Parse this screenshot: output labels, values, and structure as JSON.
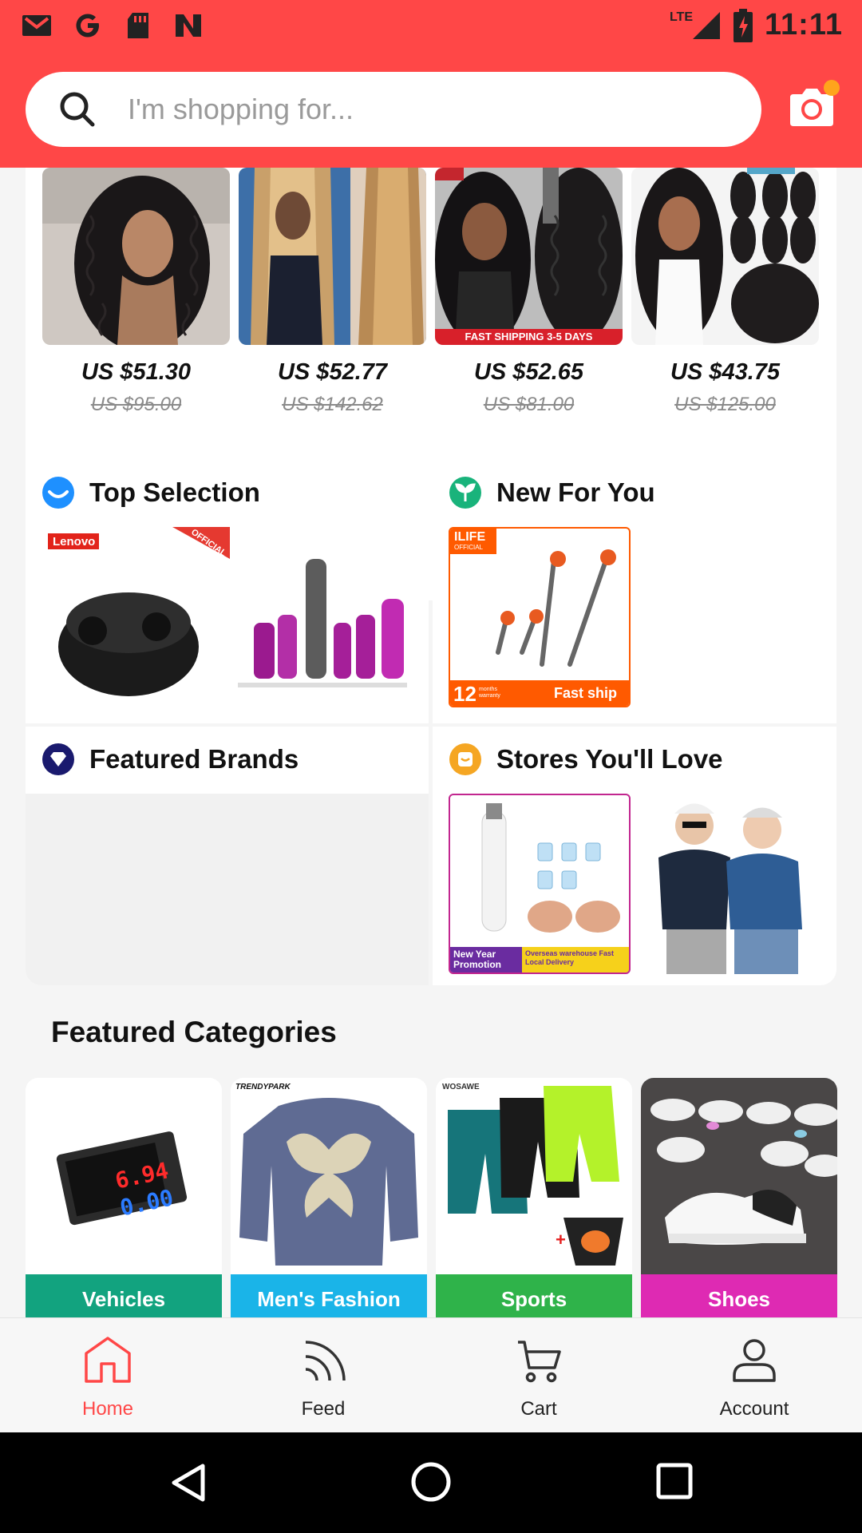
{
  "status_bar": {
    "time": "11:11",
    "network": "LTE",
    "notification_icons": [
      "gmail-icon",
      "google-icon",
      "sd-card-icon",
      "news-icon"
    ]
  },
  "search": {
    "placeholder": "I'm shopping for..."
  },
  "deals": [
    {
      "price": "US $51.30",
      "original_price": "US $95.00"
    },
    {
      "price": "US $52.77",
      "original_price": "US $142.62"
    },
    {
      "price": "US $52.65",
      "original_price": "US $81.00",
      "badge": "FAST SHIPPING 3-5 DAYS"
    },
    {
      "price": "US $43.75",
      "original_price": "US $125.00"
    }
  ],
  "tiles": {
    "top_selection": {
      "title": "Top Selection",
      "brand_tag": "Lenovo",
      "ribbon": "OFFICIAL"
    },
    "new_for_you": {
      "title": "New For You",
      "brand_tag": "ILIFE",
      "brand_sub": "OFFICIAL",
      "warranty_num": "12",
      "warranty_text": "months warranty",
      "ship_text": "Fast ship"
    },
    "featured_brands": {
      "title": "Featured Brands"
    },
    "stores": {
      "title": "Stores You'll Love",
      "promo_left": "New Year Promotion",
      "promo_right": "Overseas warehouse Fast Local Delivery"
    }
  },
  "featured_categories": {
    "title": "Featured Categories",
    "items": [
      {
        "label": "Vehicles",
        "color": "#12a37f",
        "meter_top": "6.94",
        "meter_bottom": "0.00"
      },
      {
        "label": "Men's Fashion",
        "color": "#1ab4e8",
        "brand": "TRENDYPARK"
      },
      {
        "label": "Sports",
        "color": "#2fb34a",
        "brand": "WOSAWE"
      },
      {
        "label": "Shoes",
        "color": "#de2ab3"
      }
    ]
  },
  "bottom_nav": [
    {
      "label": "Home",
      "icon": "home-icon",
      "active": true
    },
    {
      "label": "Feed",
      "icon": "feed-icon",
      "active": false
    },
    {
      "label": "Cart",
      "icon": "cart-icon",
      "active": false
    },
    {
      "label": "Account",
      "icon": "account-icon",
      "active": false
    }
  ],
  "colors": {
    "brand_red": "#ff4747",
    "active_nav": "#ff4747",
    "accent_orange": "#ffa41c"
  }
}
